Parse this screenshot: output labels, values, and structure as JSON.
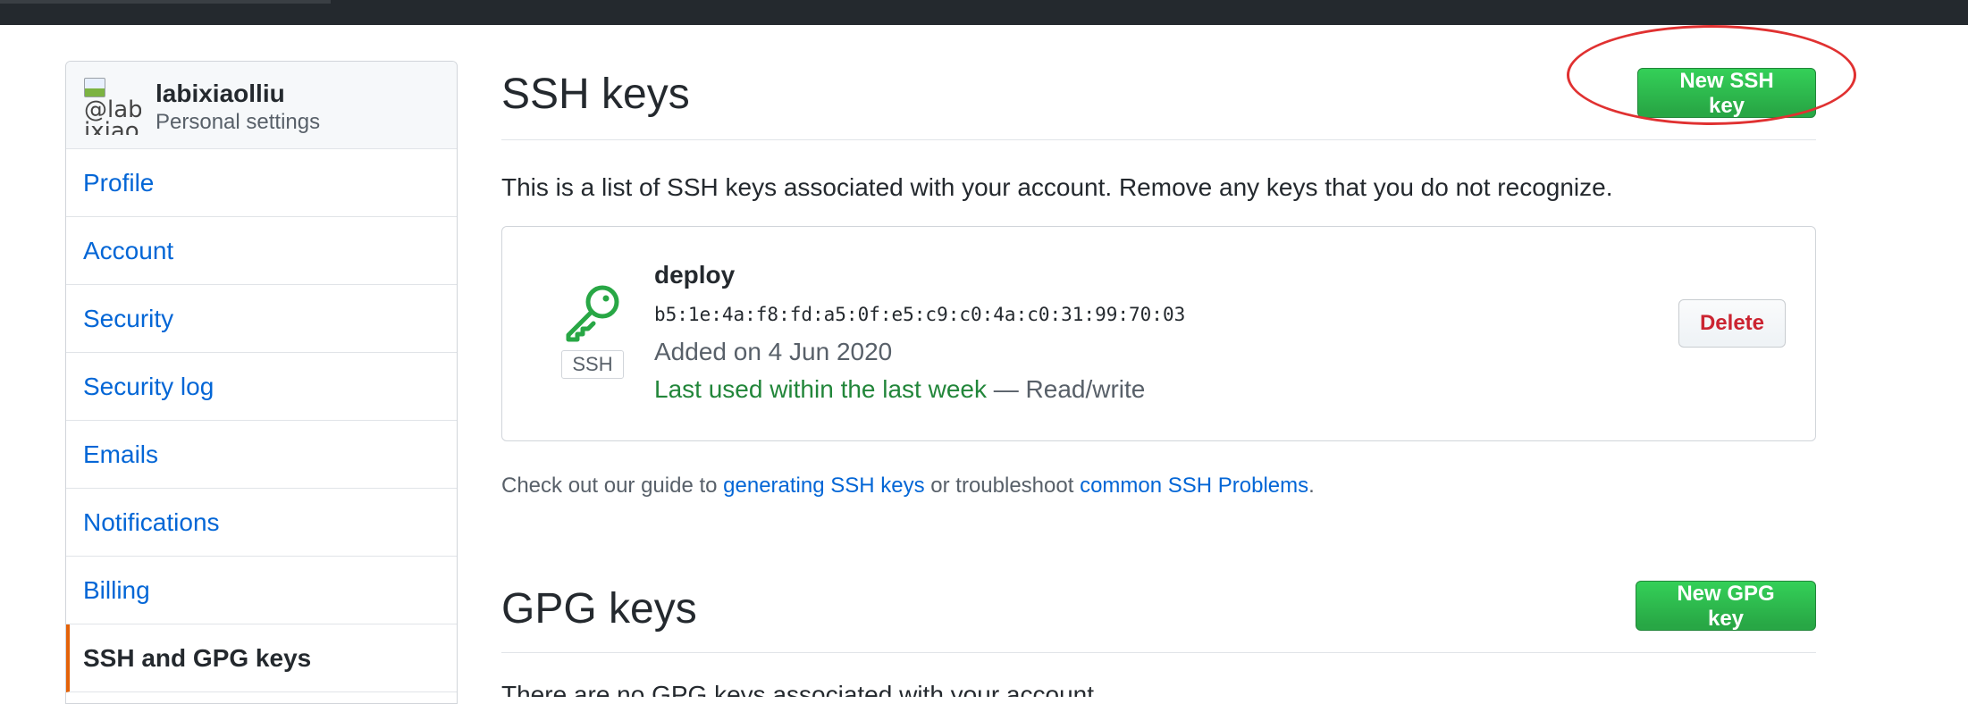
{
  "sidebar": {
    "avatar_alt": "@lab ixiao",
    "username": "labixiaolliu",
    "subtitle": "Personal settings",
    "items": [
      {
        "label": "Profile"
      },
      {
        "label": "Account"
      },
      {
        "label": "Security"
      },
      {
        "label": "Security log"
      },
      {
        "label": "Emails"
      },
      {
        "label": "Notifications"
      },
      {
        "label": "Billing"
      },
      {
        "label": "SSH and GPG keys",
        "selected": true
      }
    ]
  },
  "ssh": {
    "title": "SSH keys",
    "new_button": "New SSH key",
    "intro": "This is a list of SSH keys associated with your account. Remove any keys that you do not recognize.",
    "key": {
      "title": "deploy",
      "fingerprint": "b5:1e:4a:f8:fd:a5:0f:e5:c9:c0:4a:c0:31:99:70:03",
      "added": "Added on 4 Jun 2020",
      "last_used": "Last used within the last week",
      "access": " — Read/write",
      "type_label": "SSH",
      "icon": "key-icon",
      "delete_button": "Delete"
    },
    "guide": {
      "prefix": "Check out our guide to ",
      "link1": "generating SSH keys",
      "middle": " or troubleshoot ",
      "link2": "common SSH Problems",
      "suffix": "."
    }
  },
  "gpg": {
    "title": "GPG keys",
    "new_button": "New GPG key",
    "intro": "There are no GPG keys associated with your account."
  },
  "colors": {
    "link": "#0366d6",
    "green": "#28a745",
    "danger": "#cb2431",
    "selected_border": "#e36209",
    "highlight": "#e03131"
  }
}
